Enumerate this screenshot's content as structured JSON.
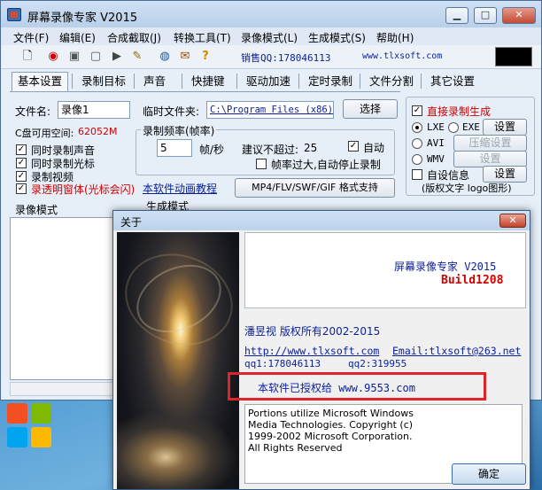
{
  "window": {
    "title": "屏幕录像专家 V2015",
    "controls": {
      "minimize": "▁",
      "maximize": "□",
      "close": "✕"
    }
  },
  "menu": [
    "文件(F)",
    "编辑(E)",
    "合成截取(J)",
    "转换工具(T)",
    "录像模式(L)",
    "生成模式(S)",
    "帮助(H)"
  ],
  "toolbar": {
    "sales": "销售QQ:178046113",
    "site": "www.tlxsoft.com"
  },
  "tabs": [
    "基本设置",
    "录制目标",
    "声音",
    "快捷键",
    "驱动加速",
    "定时录制",
    "文件分割",
    "其它设置"
  ],
  "basic": {
    "filename_label": "文件名:",
    "filename_value": "录像1",
    "tempdir_label": "临时文件夹:",
    "tempdir_value": "C:\\Program Files (x86)\\",
    "select_button": "选择",
    "disk_label": "C盘可用空间:",
    "disk_value": "62052M",
    "options": [
      {
        "label": "同时录制声音",
        "checked": true
      },
      {
        "label": "同时录制光标",
        "checked": true
      },
      {
        "label": "录制视频",
        "checked": true
      },
      {
        "label": "录透明窗体(光标会闪)",
        "checked": true
      }
    ],
    "framerate_legend": "录制频率(帧率)",
    "framerate_value": "5",
    "framerate_unit": "帧/秒",
    "suggest_label": "建议不超过:",
    "suggest_value": "25",
    "auto_label": "自动",
    "auto_stop_label": "帧率过大,自动停止录制",
    "tutorial_link": "本软件动画教程",
    "format_button": "MP4/FLV/SWF/GIF  格式支持"
  },
  "direct": {
    "title": "直接录制生成",
    "lxe": "LXE",
    "exe": "EXE",
    "avi": "AVI",
    "wmv": "WMV",
    "settings1": "设置",
    "compress": "压缩设置",
    "settings2": "设置",
    "custom_info": "自设信息",
    "settings3": "设置",
    "note": "(版权文字 logo图形)"
  },
  "lower": {
    "record_mode": "录像模式",
    "gen_mode": "生成模式"
  },
  "about": {
    "title": "关于",
    "close": "✕",
    "product": "屏幕录像专家  V2015",
    "build": "Build1208",
    "author": "潘昱视  版权所有2002-2015",
    "url": "http://www.tlxsoft.com",
    "email": "Email:tlxsoft@263.net",
    "qq1": "qq1:178046113",
    "qq2": "qq2:319955",
    "licensed": "本软件已授权给  www.9553.com",
    "notice": [
      "Portions utilize Microsoft Windows",
      "Media Technologies.  Copyright (c)",
      "1999-2002 Microsoft Corporation.",
      "All Rights Reserved"
    ],
    "ok": "确定"
  },
  "colors": {
    "accent": "#0a1f9c",
    "alert": "#d10000",
    "highlight_frame": "#e0222a"
  }
}
